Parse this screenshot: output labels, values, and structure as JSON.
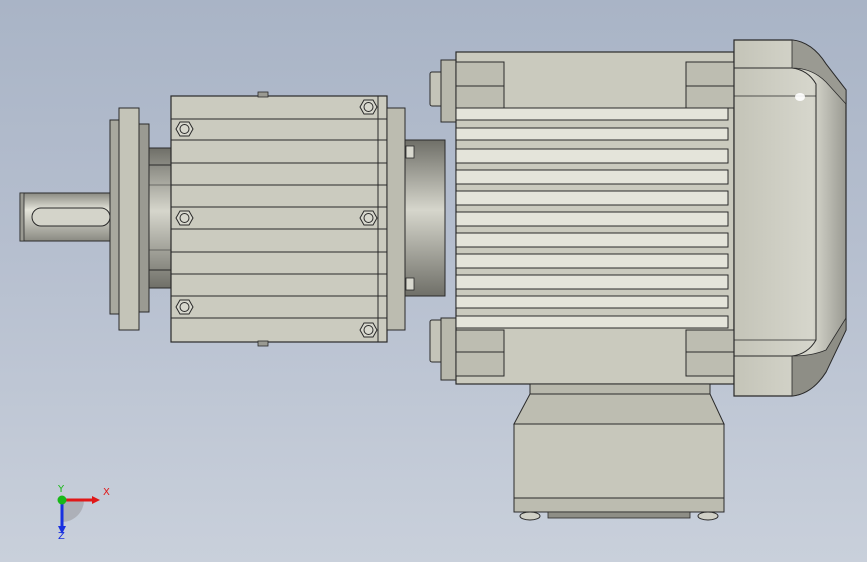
{
  "viewport": {
    "background_top": "#a9b4c6",
    "background_bottom": "#c9d0db"
  },
  "model": {
    "part_color": "#c9c9bd",
    "shadow_color": "#7c7c74",
    "edge_color": "#2a2a2a",
    "highlight_color": "#ffffff"
  },
  "triad": {
    "x_label": "X",
    "y_label": "Y",
    "z_label": "Z",
    "x_color": "#e01818",
    "y_color": "#18b818",
    "z_color": "#1830e0"
  }
}
